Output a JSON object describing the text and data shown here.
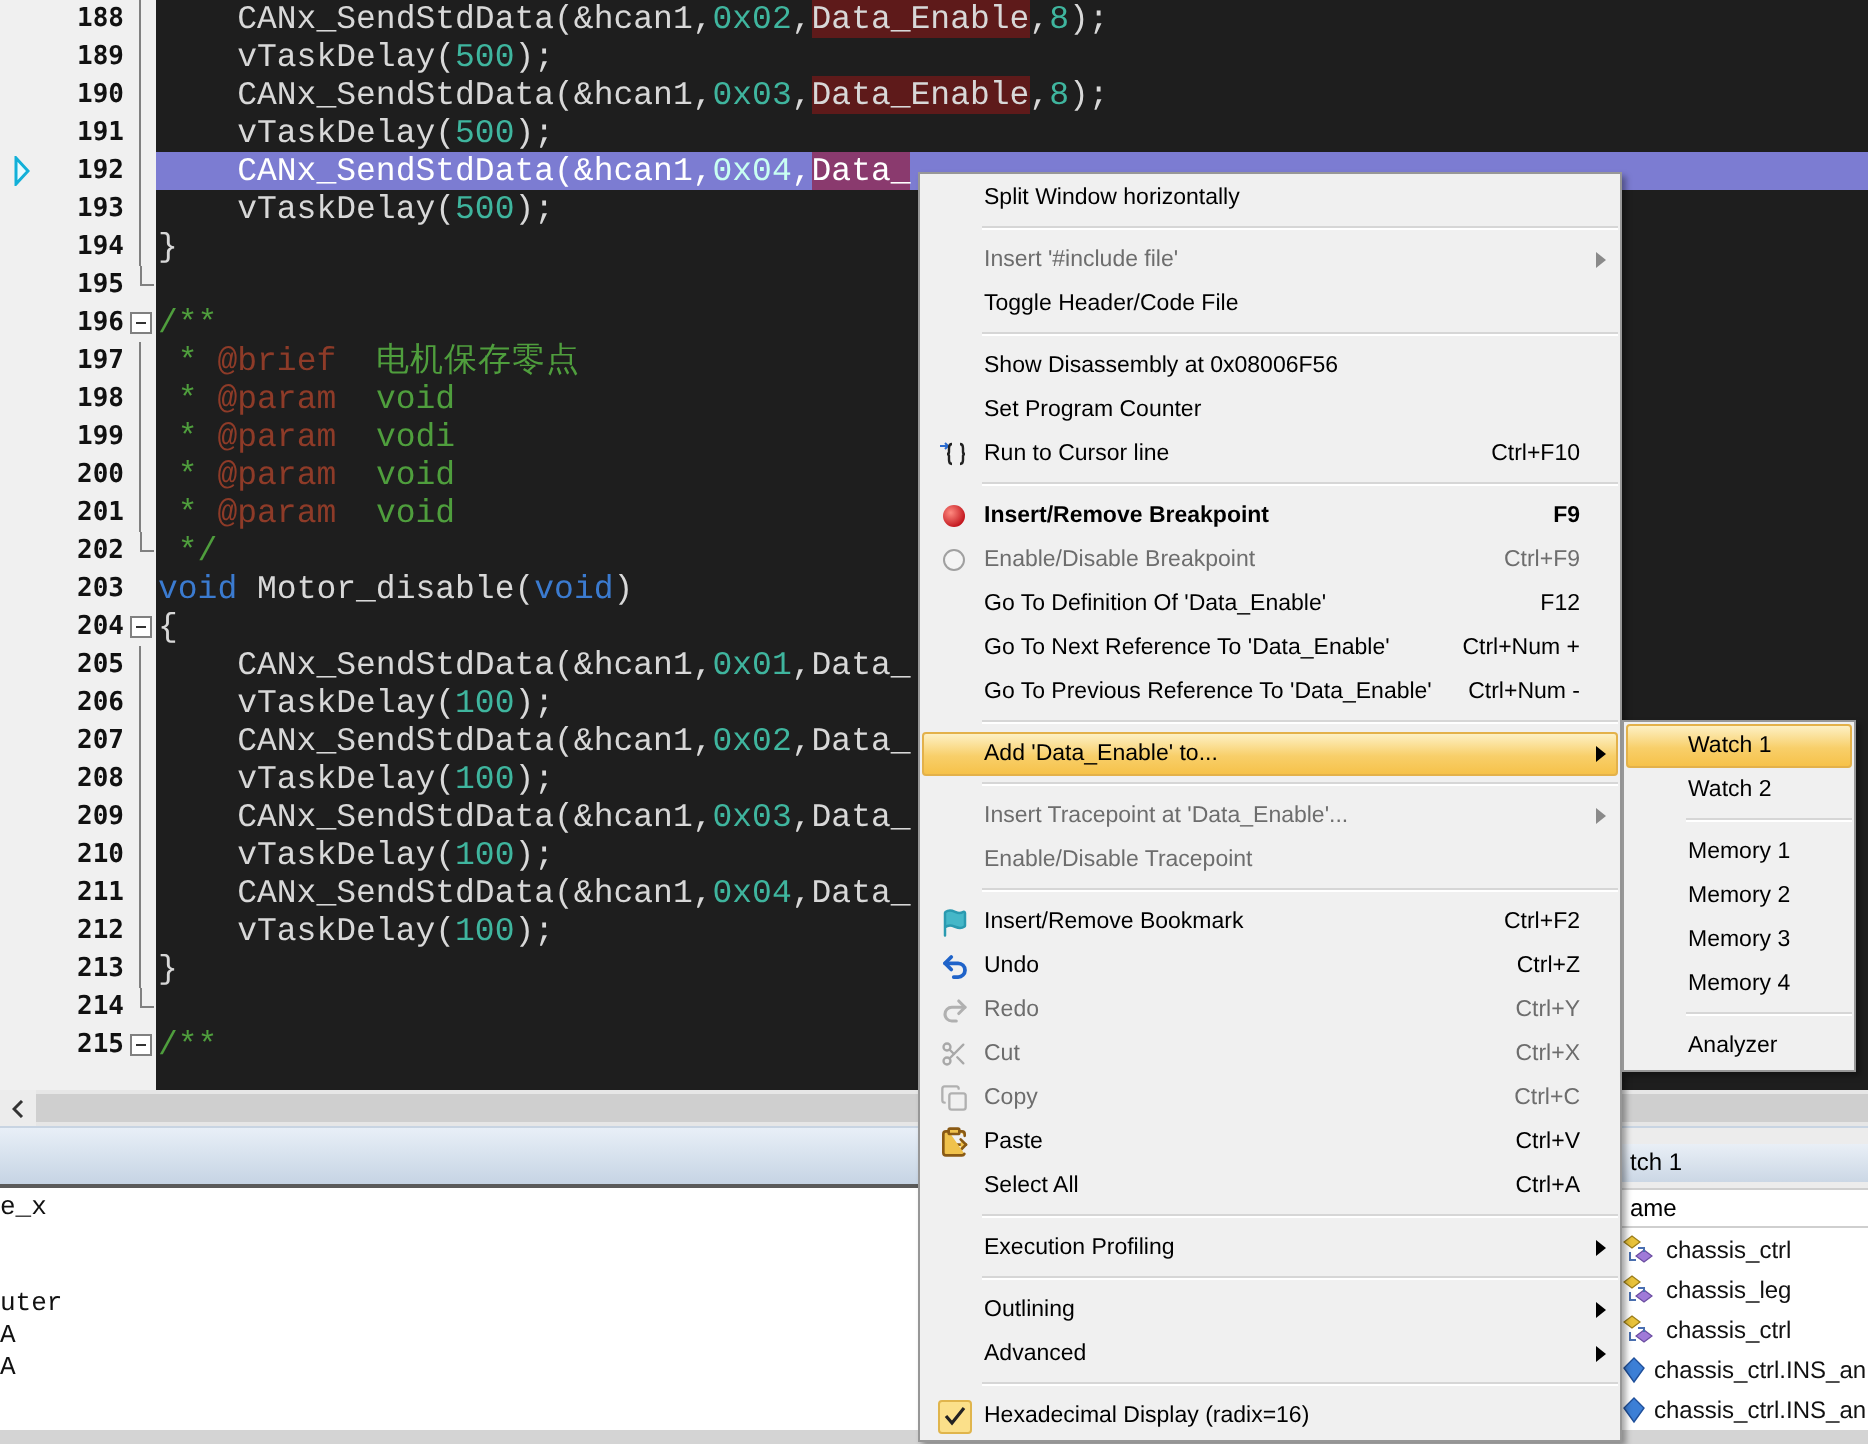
{
  "editor": {
    "lines": [
      {
        "number": "188",
        "kind": "guide",
        "current": false,
        "segments": [
          {
            "kind": "text",
            "text": "    CANx_SendStdData(&hcan1,"
          },
          {
            "kind": "number",
            "text": "0x02"
          },
          {
            "kind": "text",
            "text": ","
          },
          {
            "kind": "match",
            "text": "Data_Enable"
          },
          {
            "kind": "text",
            "text": ","
          },
          {
            "kind": "number",
            "text": "8"
          },
          {
            "kind": "text",
            "text": ");"
          }
        ]
      },
      {
        "number": "189",
        "kind": "guide",
        "current": false,
        "segments": [
          {
            "kind": "text",
            "text": "    vTaskDelay("
          },
          {
            "kind": "number",
            "text": "500"
          },
          {
            "kind": "text",
            "text": ");"
          }
        ]
      },
      {
        "number": "190",
        "kind": "guide",
        "current": false,
        "segments": [
          {
            "kind": "text",
            "text": "    CANx_SendStdData(&hcan1,"
          },
          {
            "kind": "number",
            "text": "0x03"
          },
          {
            "kind": "text",
            "text": ","
          },
          {
            "kind": "match",
            "text": "Data_Enable"
          },
          {
            "kind": "text",
            "text": ","
          },
          {
            "kind": "number",
            "text": "8"
          },
          {
            "kind": "text",
            "text": ");"
          }
        ]
      },
      {
        "number": "191",
        "kind": "guide",
        "current": false,
        "segments": [
          {
            "kind": "text",
            "text": "    vTaskDelay("
          },
          {
            "kind": "number",
            "text": "500"
          },
          {
            "kind": "text",
            "text": ");"
          }
        ]
      },
      {
        "number": "192",
        "kind": "guide",
        "current": true,
        "segments": [
          {
            "kind": "text",
            "text": "    CANx_SendStdData(&hcan1,"
          },
          {
            "kind": "number",
            "text": "0x04"
          },
          {
            "kind": "text",
            "text": ","
          },
          {
            "kind": "match",
            "text": "Data_"
          }
        ]
      },
      {
        "number": "193",
        "kind": "guide",
        "current": false,
        "segments": [
          {
            "kind": "text",
            "text": "    vTaskDelay("
          },
          {
            "kind": "number",
            "text": "500"
          },
          {
            "kind": "text",
            "text": ");"
          }
        ]
      },
      {
        "number": "194",
        "kind": "guide",
        "current": false,
        "segments": [
          {
            "kind": "text",
            "text": "}"
          }
        ]
      },
      {
        "number": "195",
        "kind": "end",
        "current": false
      },
      {
        "number": "196",
        "kind": "start",
        "current": false,
        "segments": [
          {
            "kind": "comment",
            "text": "/**"
          }
        ]
      },
      {
        "number": "197",
        "kind": "guide",
        "current": false,
        "segments": [
          {
            "kind": "comment",
            "text": " * "
          },
          {
            "kind": "tag",
            "text": "@brief"
          },
          {
            "kind": "comment",
            "text": "  电机保存零点"
          }
        ]
      },
      {
        "number": "198",
        "kind": "guide",
        "current": false,
        "segments": [
          {
            "kind": "comment",
            "text": " * "
          },
          {
            "kind": "tag",
            "text": "@param"
          },
          {
            "kind": "comment",
            "text": "  void"
          }
        ]
      },
      {
        "number": "199",
        "kind": "guide",
        "current": false,
        "segments": [
          {
            "kind": "comment",
            "text": " * "
          },
          {
            "kind": "tag",
            "text": "@param"
          },
          {
            "kind": "comment",
            "text": "  vodi"
          }
        ]
      },
      {
        "number": "200",
        "kind": "guide",
        "current": false,
        "segments": [
          {
            "kind": "comment",
            "text": " * "
          },
          {
            "kind": "tag",
            "text": "@param"
          },
          {
            "kind": "comment",
            "text": "  void"
          }
        ]
      },
      {
        "number": "201",
        "kind": "guide",
        "current": false,
        "segments": [
          {
            "kind": "comment",
            "text": " * "
          },
          {
            "kind": "tag",
            "text": "@param"
          },
          {
            "kind": "comment",
            "text": "  void"
          }
        ]
      },
      {
        "number": "202",
        "kind": "end",
        "current": false,
        "segments": [
          {
            "kind": "comment",
            "text": " */"
          }
        ]
      },
      {
        "number": "203",
        "kind": "none",
        "current": false,
        "segments": [
          {
            "kind": "keyword",
            "text": "void"
          },
          {
            "kind": "text",
            "text": " Motor_disable("
          },
          {
            "kind": "keyword",
            "text": "void"
          },
          {
            "kind": "text",
            "text": ")"
          }
        ]
      },
      {
        "number": "204",
        "kind": "start",
        "current": false,
        "segments": [
          {
            "kind": "text",
            "text": "{"
          }
        ]
      },
      {
        "number": "205",
        "kind": "guide",
        "current": false,
        "segments": [
          {
            "kind": "text",
            "text": "    CANx_SendStdData(&hcan1,"
          },
          {
            "kind": "number",
            "text": "0x01"
          },
          {
            "kind": "text",
            "text": ",Data_"
          }
        ]
      },
      {
        "number": "206",
        "kind": "guide",
        "current": false,
        "segments": [
          {
            "kind": "text",
            "text": "    vTaskDelay("
          },
          {
            "kind": "number",
            "text": "100"
          },
          {
            "kind": "text",
            "text": ");"
          }
        ]
      },
      {
        "number": "207",
        "kind": "guide",
        "current": false,
        "segments": [
          {
            "kind": "text",
            "text": "    CANx_SendStdData(&hcan1,"
          },
          {
            "kind": "number",
            "text": "0x02"
          },
          {
            "kind": "text",
            "text": ",Data_"
          }
        ]
      },
      {
        "number": "208",
        "kind": "guide",
        "current": false,
        "segments": [
          {
            "kind": "text",
            "text": "    vTaskDelay("
          },
          {
            "kind": "number",
            "text": "100"
          },
          {
            "kind": "text",
            "text": ");"
          }
        ]
      },
      {
        "number": "209",
        "kind": "guide",
        "current": false,
        "segments": [
          {
            "kind": "text",
            "text": "    CANx_SendStdData(&hcan1,"
          },
          {
            "kind": "number",
            "text": "0x03"
          },
          {
            "kind": "text",
            "text": ",Data_"
          }
        ]
      },
      {
        "number": "210",
        "kind": "guide",
        "current": false,
        "segments": [
          {
            "kind": "text",
            "text": "    vTaskDelay("
          },
          {
            "kind": "number",
            "text": "100"
          },
          {
            "kind": "text",
            "text": ");"
          }
        ]
      },
      {
        "number": "211",
        "kind": "guide",
        "current": false,
        "segments": [
          {
            "kind": "text",
            "text": "    CANx_SendStdData(&hcan1,"
          },
          {
            "kind": "number",
            "text": "0x04"
          },
          {
            "kind": "text",
            "text": ",Data_"
          }
        ]
      },
      {
        "number": "212",
        "kind": "guide",
        "current": false,
        "segments": [
          {
            "kind": "text",
            "text": "    vTaskDelay("
          },
          {
            "kind": "number",
            "text": "100"
          },
          {
            "kind": "text",
            "text": ");"
          }
        ]
      },
      {
        "number": "213",
        "kind": "guide",
        "current": false,
        "segments": [
          {
            "kind": "text",
            "text": "}"
          }
        ]
      },
      {
        "number": "214",
        "kind": "end",
        "current": false
      },
      {
        "number": "215",
        "kind": "start",
        "current": false,
        "segments": [
          {
            "kind": "comment",
            "text": "/**"
          }
        ]
      }
    ]
  },
  "context_menu": {
    "items": [
      {
        "kind": "plain",
        "label": "Split Window horizontally",
        "disabled": false,
        "submenu": false,
        "selected": false,
        "default": false,
        "checked": false
      },
      {
        "kind": "separator"
      },
      {
        "kind": "plain",
        "label": "Insert '#include file'",
        "disabled": true,
        "submenu": true,
        "selected": false,
        "default": false,
        "checked": false
      },
      {
        "kind": "plain",
        "label": "Toggle Header/Code File",
        "disabled": false,
        "submenu": false,
        "selected": false,
        "default": false,
        "checked": false
      },
      {
        "kind": "separator"
      },
      {
        "kind": "plain",
        "label": "Show Disassembly at 0x08006F56",
        "disabled": false,
        "submenu": false,
        "selected": false,
        "default": false,
        "checked": false
      },
      {
        "kind": "plain",
        "label": "Set Program Counter",
        "disabled": false,
        "submenu": false,
        "selected": false,
        "default": false,
        "checked": false
      },
      {
        "kind": "run",
        "label": "Run to Cursor line",
        "shortcut": "Ctrl+F10",
        "disabled": false,
        "submenu": false,
        "selected": false,
        "default": false,
        "checked": false
      },
      {
        "kind": "separator"
      },
      {
        "kind": "breakpoint",
        "label": "Insert/Remove Breakpoint",
        "shortcut": "F9",
        "disabled": false,
        "submenu": false,
        "selected": false,
        "default": true,
        "checked": false
      },
      {
        "kind": "toggle",
        "label": "Enable/Disable Breakpoint",
        "shortcut": "Ctrl+F9",
        "disabled": true,
        "submenu": false,
        "selected": false,
        "default": false,
        "checked": false
      },
      {
        "kind": "plain",
        "label": "Go To Definition Of 'Data_Enable'",
        "shortcut": "F12",
        "disabled": false,
        "submenu": false,
        "selected": false,
        "default": false,
        "checked": false
      },
      {
        "kind": "plain",
        "label": "Go To Next Reference To 'Data_Enable'",
        "shortcut": "Ctrl+Num +",
        "disabled": false,
        "submenu": false,
        "selected": false,
        "default": false,
        "checked": false
      },
      {
        "kind": "plain",
        "label": "Go To Previous Reference To 'Data_Enable'",
        "shortcut": "Ctrl+Num -",
        "disabled": false,
        "submenu": false,
        "selected": false,
        "default": false,
        "checked": false
      },
      {
        "kind": "separator"
      },
      {
        "kind": "plain",
        "label": "Add 'Data_Enable' to...",
        "disabled": false,
        "submenu": true,
        "selected": true,
        "default": false,
        "checked": false
      },
      {
        "kind": "separator"
      },
      {
        "kind": "plain",
        "label": "Insert Tracepoint at 'Data_Enable'...",
        "disabled": true,
        "submenu": true,
        "selected": false,
        "default": false,
        "checked": false
      },
      {
        "kind": "plain",
        "label": "Enable/Disable Tracepoint",
        "disabled": true,
        "submenu": false,
        "selected": false,
        "default": false,
        "checked": false
      },
      {
        "kind": "separator"
      },
      {
        "kind": "bookmark",
        "label": "Insert/Remove Bookmark",
        "shortcut": "Ctrl+F2",
        "disabled": false,
        "submenu": false,
        "selected": false,
        "default": false,
        "checked": false
      },
      {
        "kind": "undo",
        "label": "Undo",
        "shortcut": "Ctrl+Z",
        "disabled": false,
        "submenu": false,
        "selected": false,
        "default": false,
        "checked": false
      },
      {
        "kind": "redo",
        "label": "Redo",
        "shortcut": "Ctrl+Y",
        "disabled": true,
        "submenu": false,
        "selected": false,
        "default": false,
        "checked": false
      },
      {
        "kind": "cut",
        "label": "Cut",
        "shortcut": "Ctrl+X",
        "disabled": true,
        "submenu": false,
        "selected": false,
        "default": false,
        "checked": false
      },
      {
        "kind": "copy",
        "label": "Copy",
        "shortcut": "Ctrl+C",
        "disabled": true,
        "submenu": false,
        "selected": false,
        "default": false,
        "checked": false
      },
      {
        "kind": "paste",
        "label": "Paste",
        "shortcut": "Ctrl+V",
        "disabled": false,
        "submenu": false,
        "selected": false,
        "default": false,
        "checked": false
      },
      {
        "kind": "plain",
        "label": "Select All",
        "shortcut": "Ctrl+A",
        "disabled": false,
        "submenu": false,
        "selected": false,
        "default": false,
        "checked": false
      },
      {
        "kind": "separator"
      },
      {
        "kind": "plain",
        "label": "Execution Profiling",
        "disabled": false,
        "submenu": true,
        "selected": false,
        "default": false,
        "checked": false
      },
      {
        "kind": "separator"
      },
      {
        "kind": "plain",
        "label": "Outlining",
        "disabled": false,
        "submenu": true,
        "selected": false,
        "default": false,
        "checked": false
      },
      {
        "kind": "plain",
        "label": "Advanced",
        "disabled": false,
        "submenu": true,
        "selected": false,
        "default": false,
        "checked": false
      },
      {
        "kind": "separator"
      },
      {
        "kind": "plain",
        "label": "Hexadecimal Display (radix=16)",
        "disabled": false,
        "submenu": false,
        "selected": false,
        "default": false,
        "checked": true
      }
    ]
  },
  "submenu": {
    "items": [
      {
        "kind": "item",
        "label": "Watch 1",
        "selected": true
      },
      {
        "kind": "item",
        "label": "Watch 2",
        "selected": false
      },
      {
        "kind": "separator"
      },
      {
        "kind": "item",
        "label": "Memory 1",
        "selected": false
      },
      {
        "kind": "item",
        "label": "Memory 2",
        "selected": false
      },
      {
        "kind": "item",
        "label": "Memory 3",
        "selected": false
      },
      {
        "kind": "item",
        "label": "Memory 4",
        "selected": false
      },
      {
        "kind": "separator"
      },
      {
        "kind": "item",
        "label": "Analyzer",
        "selected": false
      }
    ]
  },
  "output": {
    "lines": [
      "e_x",
      "uter",
      "A",
      "A"
    ]
  },
  "watch": {
    "title": "tch 1",
    "column": "ame",
    "rows": [
      {
        "kind": "struct",
        "name": "chassis_ctrl"
      },
      {
        "kind": "struct",
        "name": "chassis_leg"
      },
      {
        "kind": "struct",
        "name": "chassis_ctrl"
      },
      {
        "kind": "variable",
        "name": "chassis_ctrl.INS_an"
      },
      {
        "kind": "variable",
        "name": "chassis_ctrl.INS_an"
      }
    ]
  }
}
